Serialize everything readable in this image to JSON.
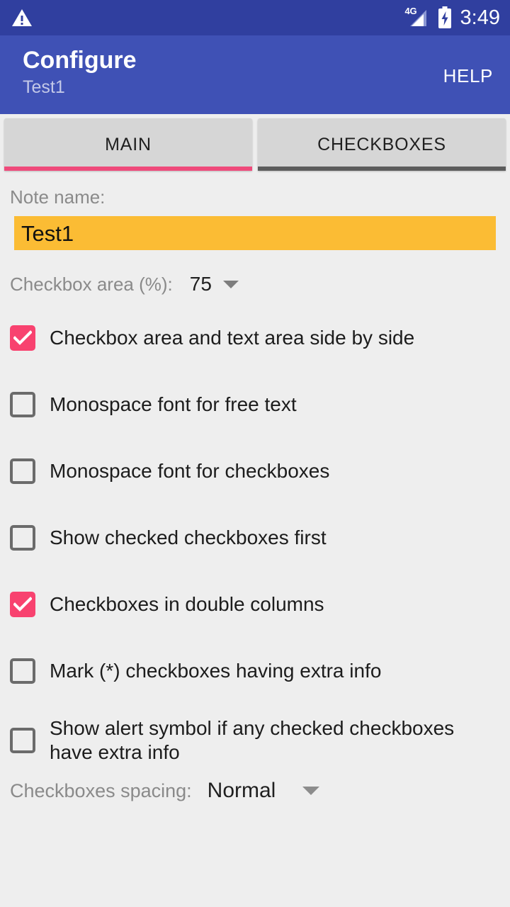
{
  "status_bar": {
    "notification_icon": "warning-triangle-icon",
    "network_label": "4G",
    "signal_icon": "signal-bars-icon",
    "battery_icon": "battery-charging-icon",
    "time": "3:49",
    "background_color": "#303f9f"
  },
  "app_bar": {
    "title": "Configure",
    "subtitle": "Test1",
    "help_label": "HELP",
    "background_color": "#3f51b5"
  },
  "tabs": [
    {
      "label": "MAIN",
      "active": true,
      "underline_color": "#ef4a7b"
    },
    {
      "label": "CHECKBOXES",
      "active": false,
      "underline_color": "#5c5c5c"
    }
  ],
  "main": {
    "note_name_label": "Note name:",
    "note_name_value": "Test1",
    "note_name_field_color": "#fbbc34",
    "checkbox_area_label": "Checkbox area (%):",
    "checkbox_area_value": "75",
    "checkboxes": [
      {
        "label": "Checkbox area and text area side by side",
        "checked": true
      },
      {
        "label": "Monospace font for free text",
        "checked": false
      },
      {
        "label": "Monospace font for checkboxes",
        "checked": false
      },
      {
        "label": "Show checked checkboxes first",
        "checked": false
      },
      {
        "label": "Checkboxes in double columns",
        "checked": true
      },
      {
        "label": "Mark (*) checkboxes having extra info",
        "checked": false
      },
      {
        "label": "Show alert symbol if any checked checkboxes have extra info",
        "checked": false
      }
    ],
    "spacing_label": "Checkboxes spacing:",
    "spacing_value": "Normal",
    "accent_color": "#f8426f"
  }
}
